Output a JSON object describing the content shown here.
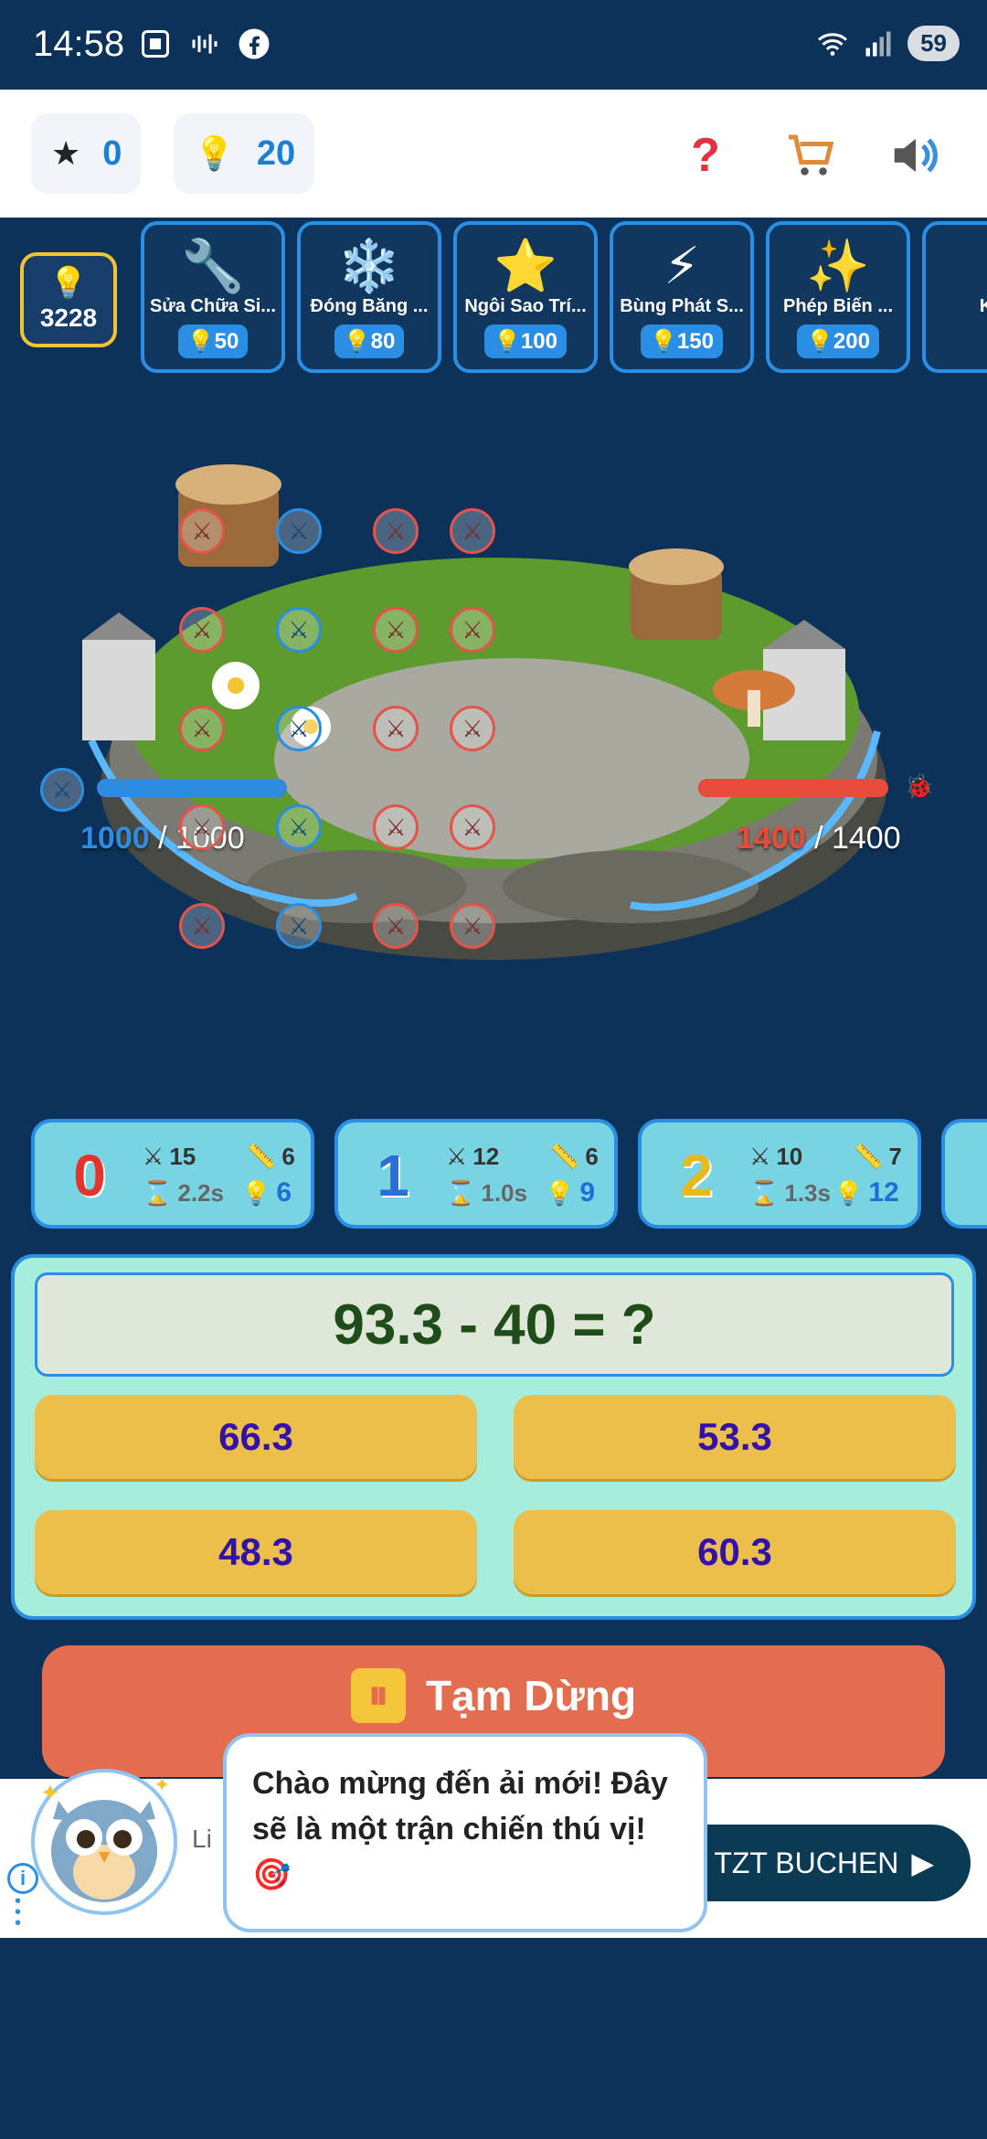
{
  "status_bar": {
    "time": "14:58",
    "battery": "59",
    "icons": [
      "screenshot-icon",
      "voice-icon",
      "facebook-icon",
      "wifi-icon",
      "signal-icon"
    ]
  },
  "resources": {
    "stars": "0",
    "bulbs": "20"
  },
  "top_actions": [
    "help-icon",
    "shop-cart-icon",
    "sound-icon"
  ],
  "bank": {
    "value": "3228"
  },
  "powerups": [
    {
      "name": "Sửa Chữa Si...",
      "cost": "50",
      "icon": "wrench-icon"
    },
    {
      "name": "Đóng Băng ...",
      "cost": "80",
      "icon": "snowflake-icon"
    },
    {
      "name": "Ngôi Sao Trí...",
      "cost": "100",
      "icon": "star-icon"
    },
    {
      "name": "Bùng Phát S...",
      "cost": "150",
      "icon": "lightning-icon"
    },
    {
      "name": "Phép Biến ...",
      "cost": "200",
      "icon": "sparkles-icon"
    },
    {
      "name": "Khi",
      "cost": "",
      "icon": "partial-icon"
    }
  ],
  "battle": {
    "left_hp_current": "1000",
    "left_hp_max": " / 1000",
    "left_hp_fraction": 1.0,
    "right_hp_current": "1400",
    "right_hp_max": " / 1400",
    "right_hp_fraction": 1.0,
    "colors": {
      "left": "#2f8be0",
      "right": "#e94b3b"
    }
  },
  "heroes": [
    {
      "digit": "0",
      "attack": "15",
      "range": "6",
      "speed": "2.2s",
      "cost": "6"
    },
    {
      "digit": "1",
      "attack": "12",
      "range": "6",
      "speed": "1.0s",
      "cost": "9"
    },
    {
      "digit": "2",
      "attack": "10",
      "range": "7",
      "speed": "1.3s",
      "cost": "12"
    }
  ],
  "question": {
    "text": "93.3 - 40 = ?",
    "answers": [
      "66.3",
      "53.3",
      "48.3",
      "60.3"
    ]
  },
  "pause_label": "Tạm Dừng",
  "ad": {
    "partial_text": "Li",
    "cta": "TZT BUCHEN"
  },
  "mascot": {
    "message": "Chào mừng đến ải mới! Đây sẽ là một trận chiến thú vị! 🎯"
  }
}
